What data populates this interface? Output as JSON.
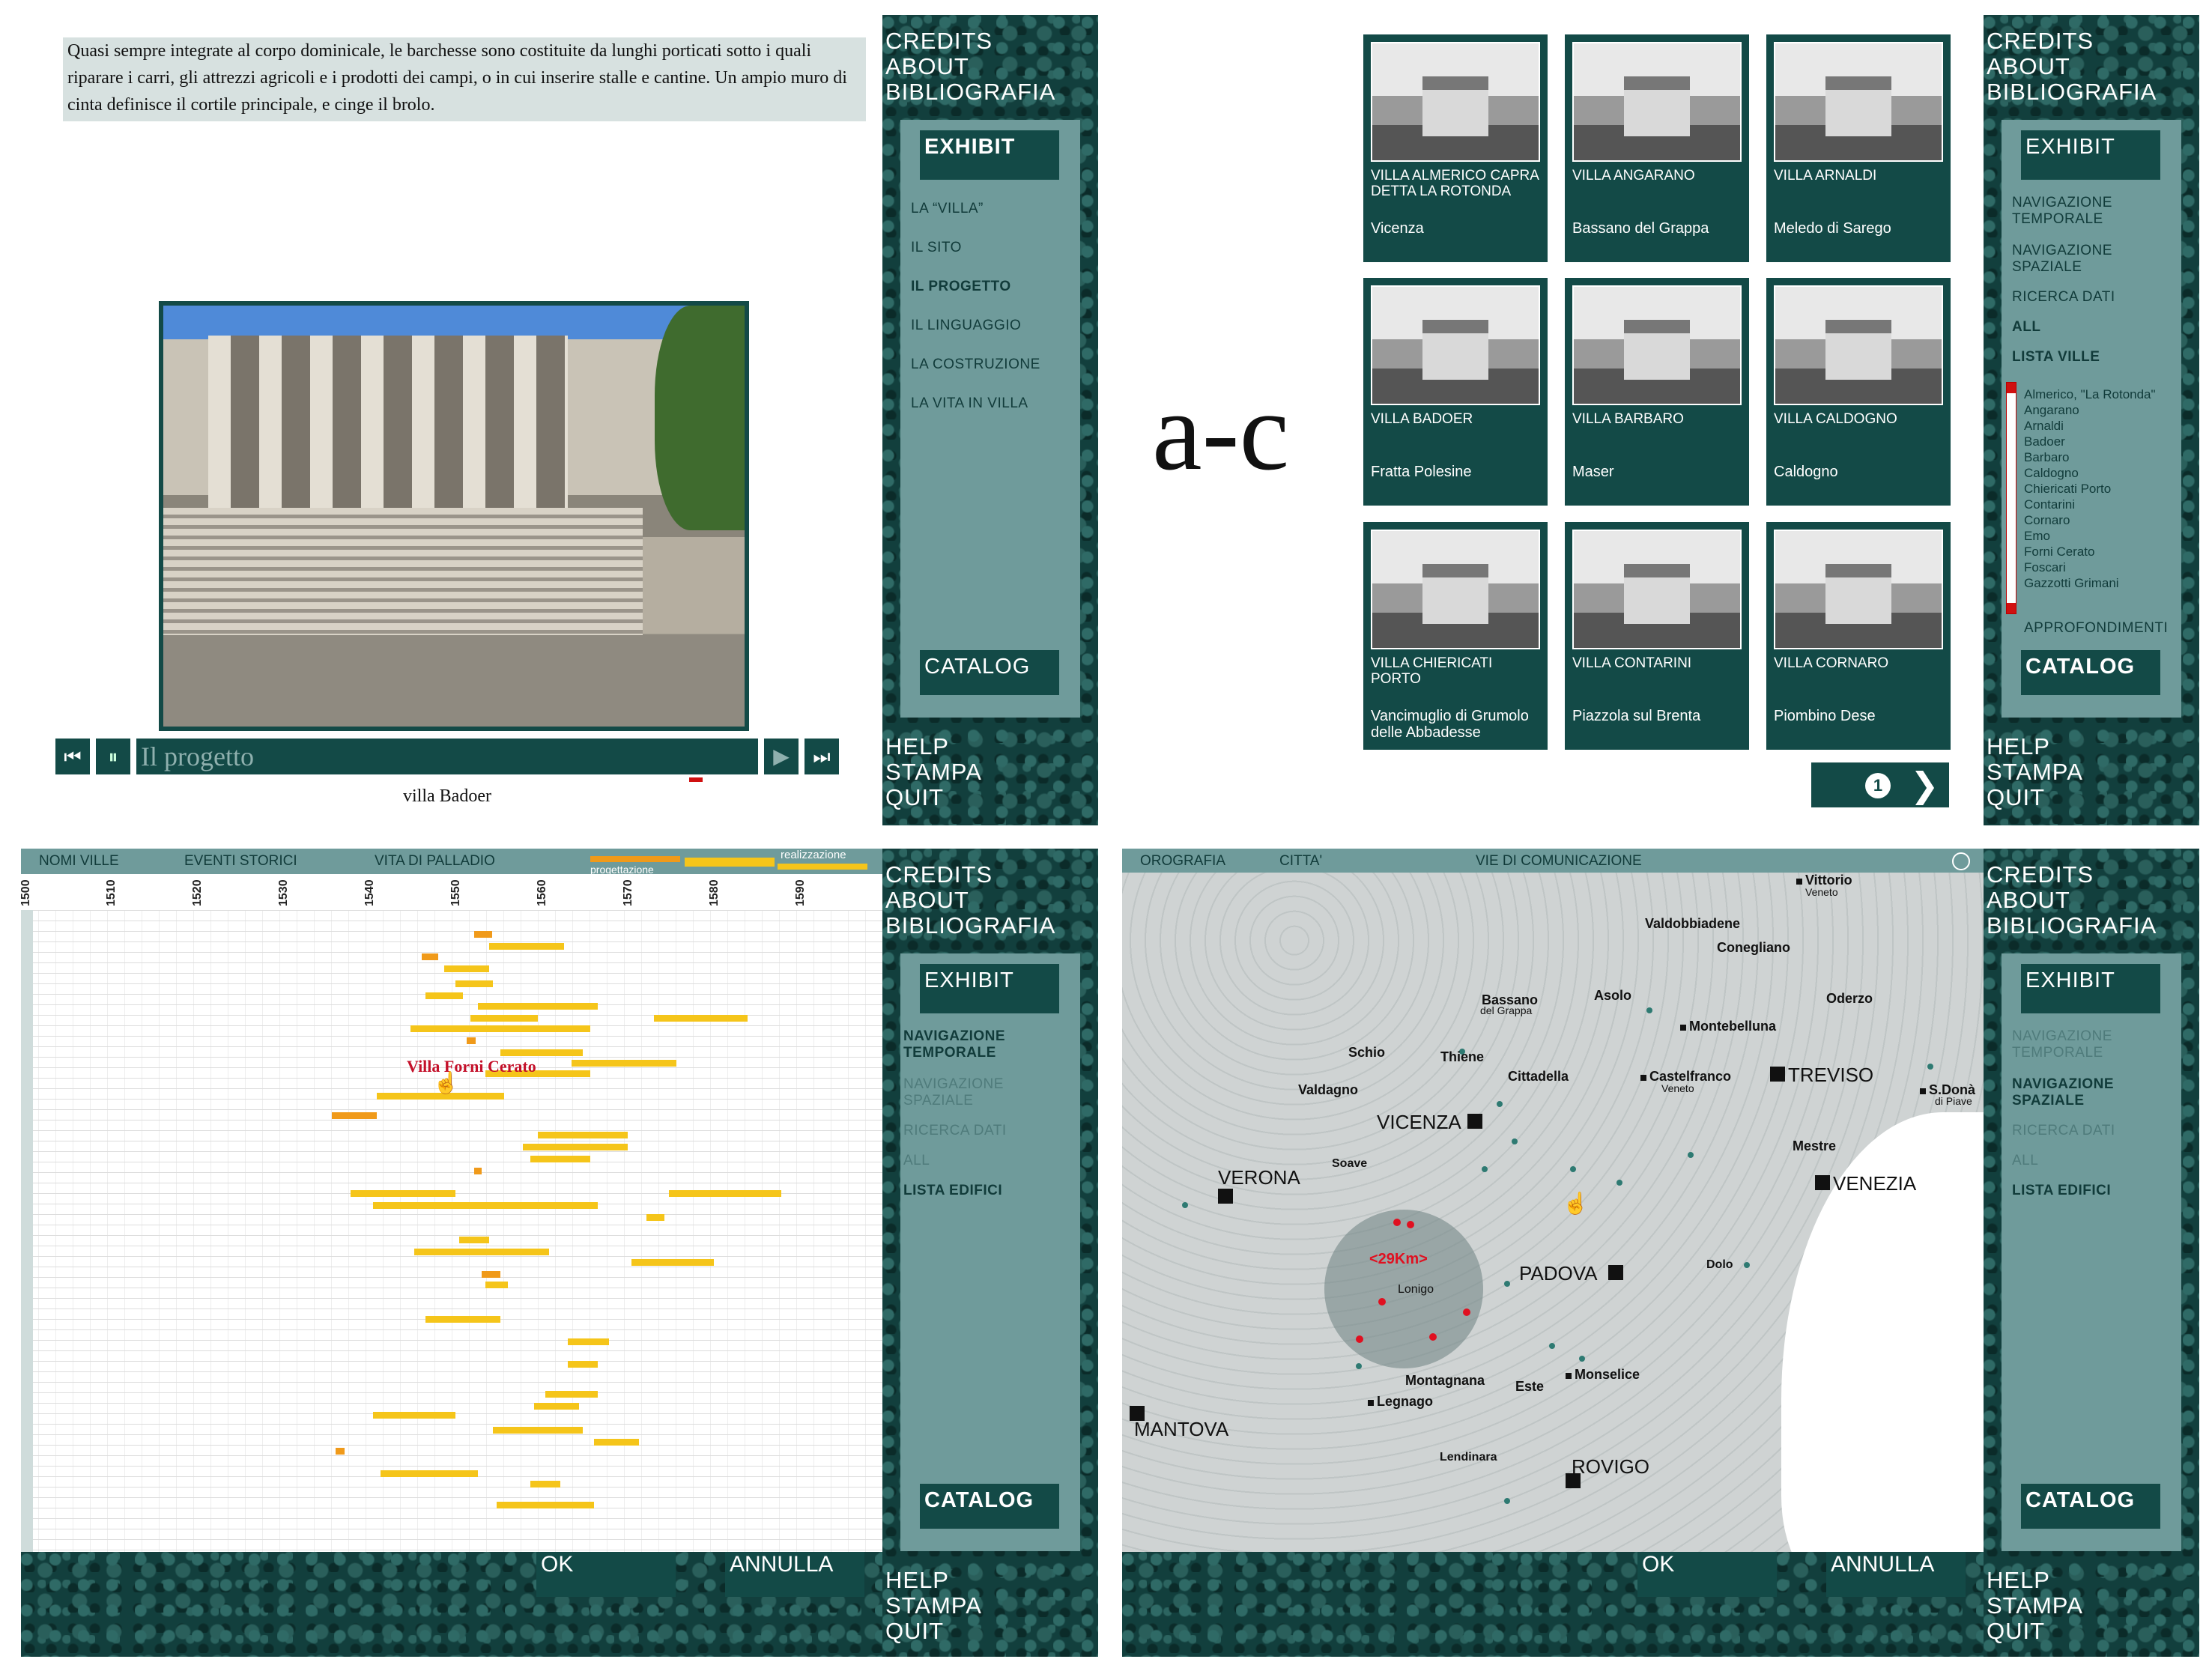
{
  "figure_label": "a-c",
  "sidebar": {
    "top": [
      "CREDITS",
      "ABOUT",
      "BIBLIOGRAFIA"
    ],
    "exhibit": "EXHIBIT",
    "catalog": "CATALOG",
    "bottom": [
      "HELP",
      "STAMPA",
      "QUIT"
    ]
  },
  "screen_a": {
    "text": "Quasi sempre integrate al corpo dominicale, le barchesse sono costituite da lunghi porticati sotto i quali riparare i carri, gli attrezzi agricoli e i prodotti dei campi, o in cui inserire stalle e cantine. Un ampio muro di cinta definisce il cortile principale, e cinge il brolo.",
    "player_title": "Il progetto",
    "caption": "villa Badoer",
    "nav": [
      "LA “VILLA”",
      "IL SITO",
      "IL PROGETTO",
      "IL LINGUAGGIO",
      "LA COSTRUZIONE",
      "LA VITA IN VILLA"
    ],
    "nav_active": "IL PROGETTO"
  },
  "screen_b": {
    "cards": [
      {
        "name": "VILLA ALMERICO CAPRA DETTA LA ROTONDA",
        "place": "Vicenza"
      },
      {
        "name": "VILLA ANGARANO",
        "place": "Bassano del Grappa"
      },
      {
        "name": "VILLA ARNALDI",
        "place": "Meledo di Sarego"
      },
      {
        "name": "VILLA BADOER",
        "place": "Fratta Polesine"
      },
      {
        "name": "VILLA BARBARO",
        "place": "Maser"
      },
      {
        "name": "VILLA CALDOGNO",
        "place": "Caldogno"
      },
      {
        "name": "VILLA CHIERICATI PORTO",
        "place": "Vancimuglio di Grumolo delle Abbadesse"
      },
      {
        "name": "VILLA CONTARINI",
        "place": "Piazzola sul Brenta"
      },
      {
        "name": "VILLA CORNARO",
        "place": "Piombino Dese"
      }
    ],
    "page": "1",
    "nav": [
      "NAVIGAZIONE TEMPORALE",
      "NAVIGAZIONE SPAZIALE",
      "RICERCA DATI",
      "ALL",
      "LISTA VILLE"
    ],
    "list": [
      "Almerico, \"La Rotonda\"",
      "Angarano",
      "Arnaldi",
      "Badoer",
      "Barbaro",
      "Caldogno",
      "Chiericati Porto",
      "Contarini",
      "Cornaro",
      "Emo",
      "Forni Cerato",
      "Foscari",
      "Gazzotti Grimani"
    ],
    "approfondimenti": "APPROFONDIMENTI"
  },
  "screen_c1": {
    "tabs": [
      "NOMI VILLE",
      "EVENTI STORICI",
      "VITA DI PALLADIO"
    ],
    "legend": [
      "progettazione",
      "realizzazione"
    ],
    "years": [
      "1500",
      "1510",
      "1520",
      "1530",
      "1540",
      "1550",
      "1560",
      "1570",
      "1580",
      "1590"
    ],
    "highlight": "Villa Forni Cerato",
    "nav": [
      "NAVIGAZIONE TEMPORALE",
      "NAVIGAZIONE SPAZIALE",
      "RICERCA DATI",
      "ALL",
      "LISTA EDIFICI"
    ],
    "ok": "OK",
    "cancel": "ANNULLA"
  },
  "screen_c2": {
    "tabs": [
      "OROGRAFIA",
      "CITTA'",
      "VIE DI COMUNICAZIONE"
    ],
    "radius": "<29Km>",
    "cities": [
      "Vittorio",
      "Veneto",
      "Valdobbiadene",
      "Conegliano",
      "Bassano",
      "del Grappa",
      "Asolo",
      "Oderzo",
      "Montebelluna",
      "Schio",
      "Thiene",
      "Cittadella",
      "Castelfranco",
      "Veneto",
      "TREVISO",
      "S.Donà",
      "di Piave",
      "Valdagno",
      "VICENZA",
      "Mestre",
      "VERONA",
      "Soave",
      "Lonigo",
      "PADOVA",
      "Dolo",
      "VENEZIA",
      "Montagnana",
      "Este",
      "Monselice",
      "Legnago",
      "MANTOVA",
      "Lendinara",
      "ROVIGO"
    ],
    "nav": [
      "NAVIGAZIONE TEMPORALE",
      "NAVIGAZIONE SPAZIALE",
      "RICERCA DATI",
      "ALL",
      "LISTA EDIFICI"
    ],
    "ok": "OK",
    "cancel": "ANNULLA"
  }
}
